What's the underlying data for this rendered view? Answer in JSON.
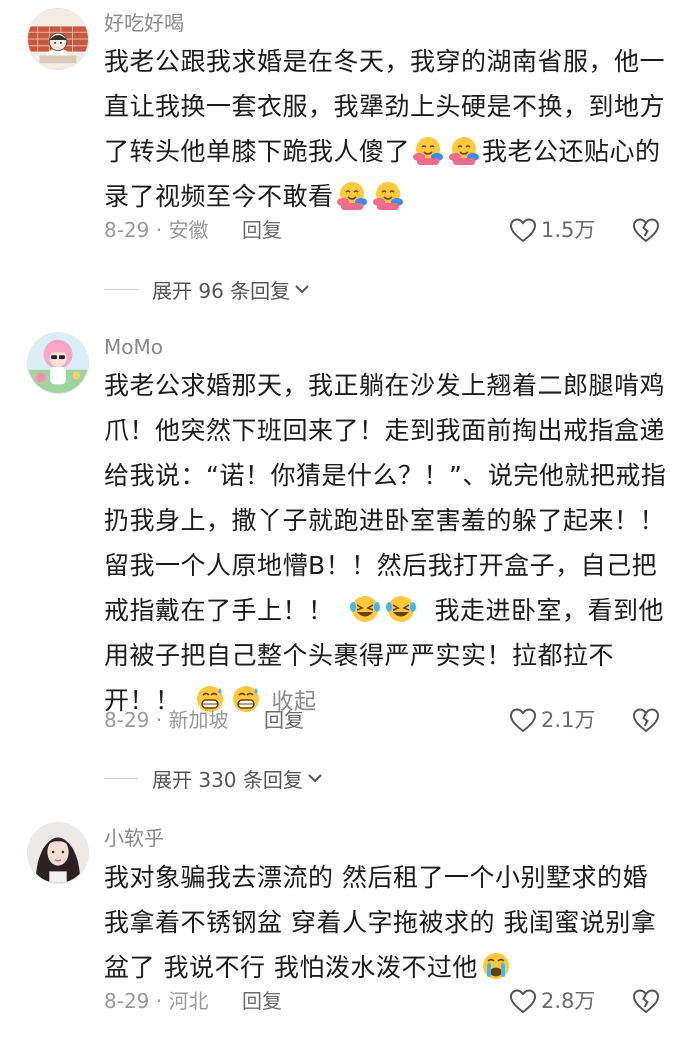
{
  "comments": [
    {
      "username": "好吃好喝",
      "avatar": "cartoon-avatar-icon",
      "text_segments": [
        "我老公跟我求婚是在冬天，我穿的湖南省服，他一直让我换一套衣服，我犟劲上头硬是不换，到地方了转头他单膝下跪我人傻了",
        "我老公还贴心的录了视频至今不敢看"
      ],
      "emojis": [
        "hugging-face-emoji",
        "hugging-face-emoji",
        "hugging-face-emoji",
        "hugging-face-emoji"
      ],
      "time_location": "8-29 · 安徽",
      "reply_label": "回复",
      "like_count": "1.5万",
      "expand_label": "展开 96 条回复"
    },
    {
      "username": "MoMo",
      "avatar": "pink-hair-avatar-icon",
      "text_segments": [
        "我老公求婚那天，我正躺在沙发上翘着二郎腿啃鸡爪！他突然下班回来了！走到我面前掏出戒指盒递给我说：“诺！你猜是什么？！”、说完他就把戒指扔我身上，撒丫子就跑进卧室害羞的躲了起来！！留我一个人原地懵B！！然后我打开盒子，自己把戒指戴在了手上！！",
        "我走进卧室，看到他用被子把自己整个头裹得严严实实！拉都拉不开！！"
      ],
      "emojis": [
        "laughing-crying-emoji",
        "laughing-crying-emoji",
        "grinning-sweat-emoji",
        "grinning-sweat-emoji"
      ],
      "collapse_label": "收起",
      "time_location": "8-29 · 新加坡",
      "reply_label": "回复",
      "like_count": "2.1万",
      "expand_label": "展开 330 条回复"
    },
    {
      "username": "小软乎",
      "avatar": "girl-photo-avatar-icon",
      "text_segments": [
        "我对象骗我去漂流的 然后租了一个小别墅求的婚我拿着不锈钢盆 穿着人字拖被求的 我闺蜜说别拿盆了 我说不行 我怕泼水泼不过他"
      ],
      "emojis": [
        "loudly-crying-emoji"
      ],
      "time_location": "8-29 · 河北",
      "reply_label": "回复",
      "like_count": "2.8万"
    }
  ],
  "colors": {
    "text": "#1c1c1c",
    "meta": "#999999",
    "username": "#8a8a8a",
    "emoji_yellow": "#ffc83d",
    "emoji_pink": "#f46a8a",
    "emoji_blue": "#3d8bff"
  }
}
